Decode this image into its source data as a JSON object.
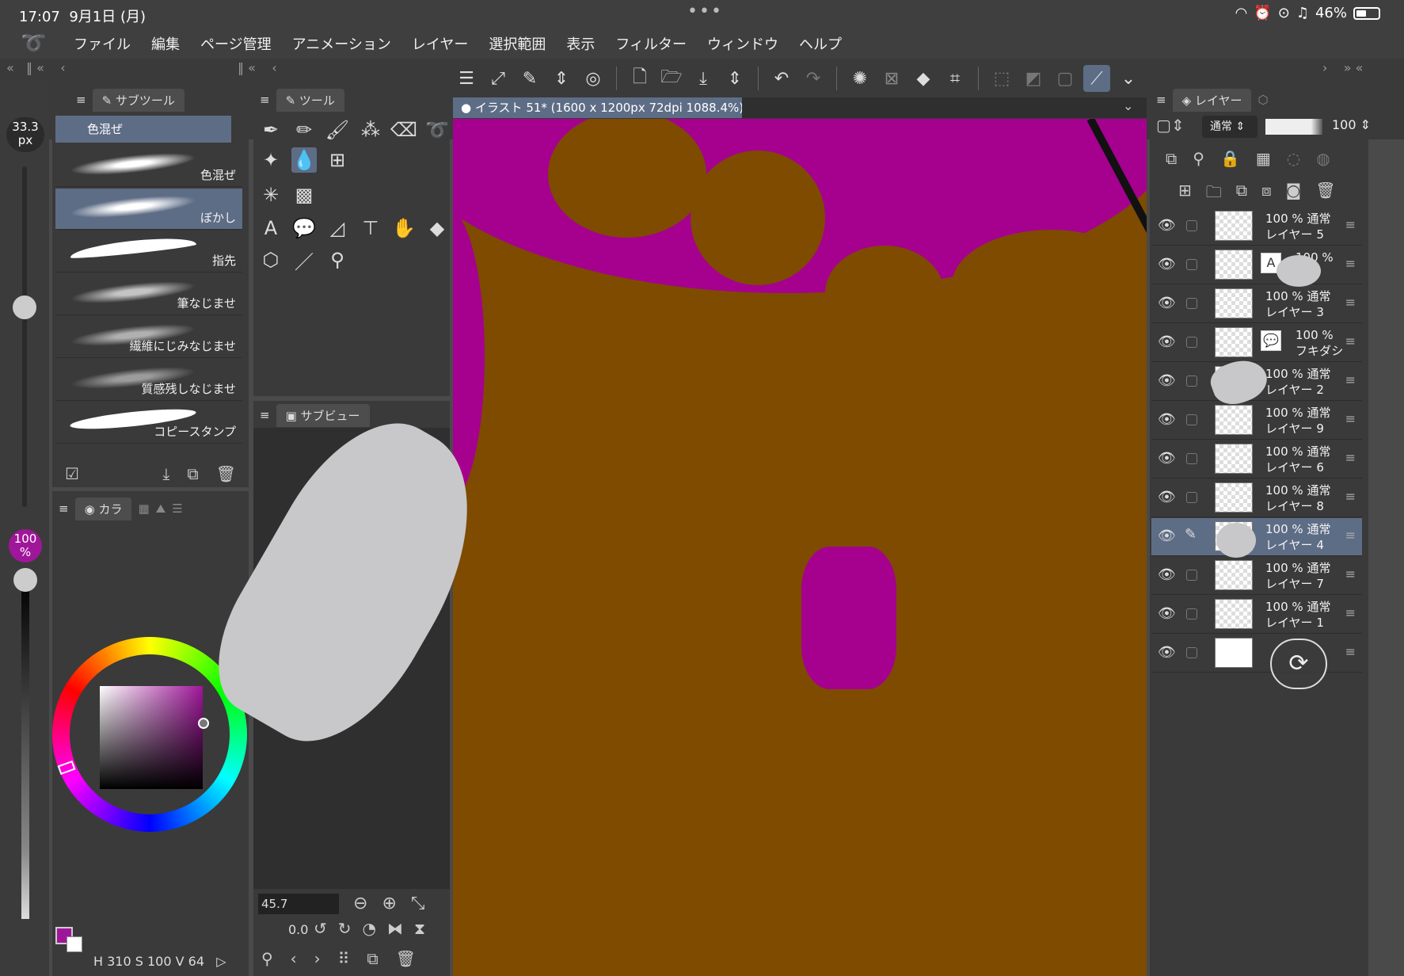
{
  "status_bar": {
    "time": "17:07",
    "date": "9月1日 (月)",
    "battery": "46%"
  },
  "menu": {
    "items": [
      "ファイル",
      "編集",
      "ページ管理",
      "アニメーション",
      "レイヤー",
      "選択範囲",
      "表示",
      "フィルター",
      "ウィンドウ",
      "ヘルプ"
    ]
  },
  "tool_settings": {
    "brush_size_value": "33.3",
    "brush_size_unit": "px",
    "opacity_value": "100",
    "opacity_unit": "%"
  },
  "subtool_panel": {
    "tab_label": "サブツール",
    "selected_group": "色混ぜ",
    "brushes": [
      {
        "label": "色混ぜ"
      },
      {
        "label": "ぼかし"
      },
      {
        "label": "指先"
      },
      {
        "label": "筆なじませ"
      },
      {
        "label": "繊維にじみなじませ"
      },
      {
        "label": "質感残しなじませ"
      },
      {
        "label": "コピースタンプ"
      }
    ],
    "selected_brush": "ぼかし"
  },
  "color_panel": {
    "tab_label": "カラ",
    "hsv_text": "H 310 S 100 V 64",
    "main_color": "#a0169a",
    "sub_color": "#ffffff"
  },
  "tool_panel": {
    "tab_label": "ツール"
  },
  "subview_panel": {
    "tab_label": "サブビュー"
  },
  "navigator": {
    "zoom_value": "45.7",
    "rotation_value": "0.0"
  },
  "canvas": {
    "tab_title": "イラスト 51* (1600 x 1200px 72dpi 1088.4%)",
    "background_color": "#7e4b00",
    "blend_color": "#a6008f"
  },
  "layer_panel": {
    "tab_label": "レイヤー",
    "blend_mode": "通常",
    "opacity": "100",
    "layers": [
      {
        "opacity": "100 %",
        "mode": "通常",
        "name": "レイヤー 5",
        "type": "raster"
      },
      {
        "opacity": "100 %",
        "mode": "",
        "name": "",
        "type": "text"
      },
      {
        "opacity": "100 %",
        "mode": "通常",
        "name": "レイヤー 3",
        "type": "raster"
      },
      {
        "opacity": "100 %",
        "mode": "",
        "name": "フキダシ",
        "type": "balloon"
      },
      {
        "opacity": "100 %",
        "mode": "通常",
        "name": "レイヤー 2",
        "type": "raster"
      },
      {
        "opacity": "100 %",
        "mode": "通常",
        "name": "レイヤー 9",
        "type": "raster"
      },
      {
        "opacity": "100 %",
        "mode": "通常",
        "name": "レイヤー 6",
        "type": "raster"
      },
      {
        "opacity": "100 %",
        "mode": "通常",
        "name": "レイヤー 8",
        "type": "raster"
      },
      {
        "opacity": "100 %",
        "mode": "通常",
        "name": "レイヤー 4",
        "type": "raster",
        "selected": true
      },
      {
        "opacity": "100 %",
        "mode": "通常",
        "name": "レイヤー 7",
        "type": "raster"
      },
      {
        "opacity": "100 %",
        "mode": "通常",
        "name": "レイヤー 1",
        "type": "raster"
      },
      {
        "opacity": "",
        "mode": "",
        "name": "",
        "type": "paper"
      }
    ]
  },
  "accent_color": "#5e6d86"
}
